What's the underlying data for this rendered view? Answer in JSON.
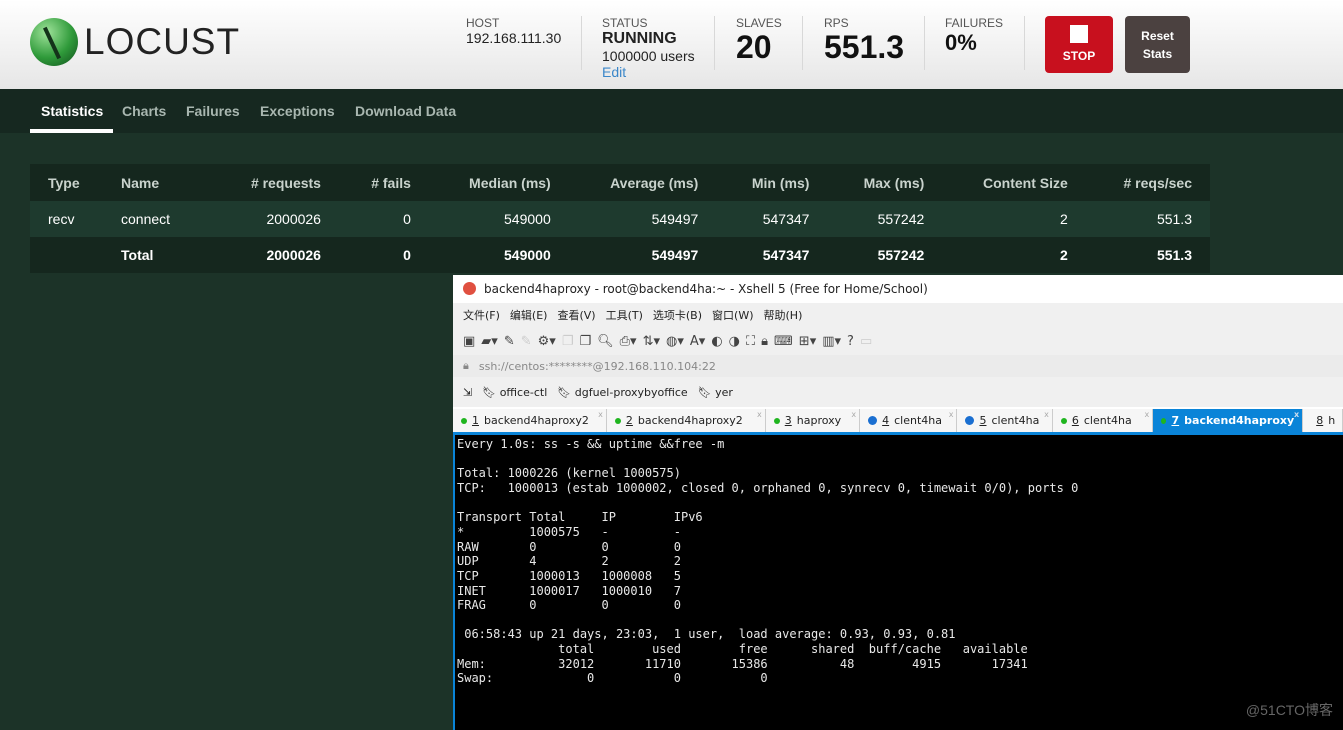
{
  "header": {
    "logo": "LOCUST",
    "host_label": "HOST",
    "host": "192.168.111.30",
    "status_label": "STATUS",
    "status": "RUNNING",
    "users": "1000000 users",
    "edit": "Edit",
    "slaves_label": "SLAVES",
    "slaves": "20",
    "rps_label": "RPS",
    "rps": "551.3",
    "failures_label": "FAILURES",
    "failures": "0%",
    "stop": "STOP",
    "reset": "Reset Stats"
  },
  "nav": {
    "tabs": [
      "Statistics",
      "Charts",
      "Failures",
      "Exceptions",
      "Download Data"
    ],
    "active": "Statistics"
  },
  "table": {
    "columns": [
      "Type",
      "Name",
      "# requests",
      "# fails",
      "Median (ms)",
      "Average (ms)",
      "Min (ms)",
      "Max (ms)",
      "Content Size",
      "# reqs/sec"
    ],
    "rows": [
      [
        "recv",
        "connect",
        "2000026",
        "0",
        "549000",
        "549497",
        "547347",
        "557242",
        "2",
        "551.3"
      ],
      [
        "",
        "Total",
        "2000026",
        "0",
        "549000",
        "549497",
        "547347",
        "557242",
        "2",
        "551.3"
      ]
    ]
  },
  "xshell": {
    "title": "backend4haproxy - root@backend4ha:~ - Xshell 5 (Free for Home/School)",
    "menu": [
      "文件(F)",
      "编辑(E)",
      "查看(V)",
      "工具(T)",
      "选项卡(B)",
      "窗口(W)",
      "帮助(H)"
    ],
    "address": "ssh://centos:********@192.168.110.104:22",
    "links": [
      "office-ctl",
      "dgfuel-proxybyoffice",
      "yer"
    ],
    "tabs": [
      {
        "n": "1",
        "label": "backend4haproxy2",
        "icon": "dot"
      },
      {
        "n": "2",
        "label": "backend4haproxy2",
        "icon": "dot"
      },
      {
        "n": "3",
        "label": "haproxy",
        "icon": "dot"
      },
      {
        "n": "4",
        "label": "clent4ha",
        "icon": "info"
      },
      {
        "n": "5",
        "label": "clent4ha",
        "icon": "info"
      },
      {
        "n": "6",
        "label": "clent4ha",
        "icon": "dot"
      },
      {
        "n": "7",
        "label": "backend4haproxy",
        "icon": "dot",
        "active": true
      },
      {
        "n": "8",
        "label": "h",
        "icon": "dot"
      }
    ],
    "terminal": [
      "Every 1.0s: ss -s && uptime &&free -m",
      "",
      "Total: 1000226 (kernel 1000575)",
      "TCP:   1000013 (estab 1000002, closed 0, orphaned 0, synrecv 0, timewait 0/0), ports 0",
      "",
      "Transport Total     IP        IPv6",
      "*         1000575   -         -",
      "RAW       0         0         0",
      "UDP       4         2         2",
      "TCP       1000013   1000008   5",
      "INET      1000017   1000010   7",
      "FRAG      0         0         0",
      "",
      " 06:58:43 up 21 days, 23:03,  1 user,  load average: 0.93, 0.93, 0.81",
      "              total        used        free      shared  buff/cache   available",
      "Mem:          32012       11710       15386          48        4915       17341",
      "Swap:             0           0           0"
    ]
  },
  "watermark": "@51CTO博客"
}
